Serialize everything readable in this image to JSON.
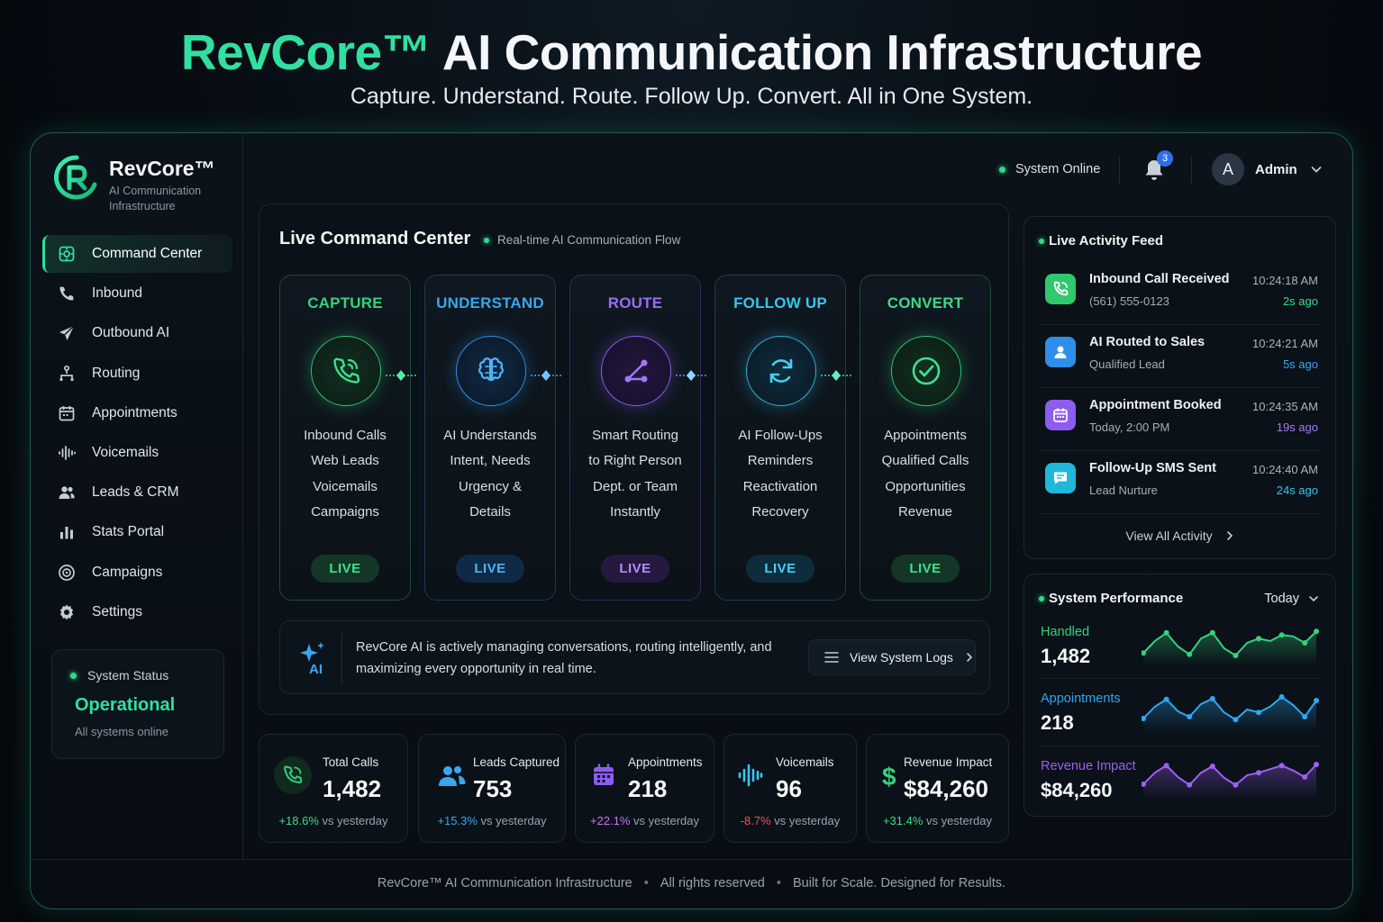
{
  "hero": {
    "brand": "RevCore™",
    "title_rest": " AI Communication Infrastructure",
    "subtitle": "Capture. Understand. Route. Follow Up. Convert. All in One System."
  },
  "sidebar": {
    "logo_name": "RevCore™",
    "logo_tagline": "AI Communication Infrastructure",
    "items": [
      {
        "label": "Command Center",
        "icon": "dashboard-icon",
        "active": true
      },
      {
        "label": "Inbound",
        "icon": "phone-icon"
      },
      {
        "label": "Outbound AI",
        "icon": "send-icon"
      },
      {
        "label": "Routing",
        "icon": "routing-icon"
      },
      {
        "label": "Appointments",
        "icon": "calendar-icon"
      },
      {
        "label": "Voicemails",
        "icon": "waveform-icon"
      },
      {
        "label": "Leads & CRM",
        "icon": "users-icon"
      },
      {
        "label": "Stats Portal",
        "icon": "bar-chart-icon"
      },
      {
        "label": "Campaigns",
        "icon": "target-icon"
      },
      {
        "label": "Settings",
        "icon": "gear-icon"
      }
    ],
    "system_status": {
      "label": "System Status",
      "value": "Operational",
      "sub": "All systems online"
    }
  },
  "header": {
    "status": "System Online",
    "notification_count": "3",
    "avatar_letter": "A",
    "user": "Admin"
  },
  "command_center": {
    "title": "Live Command Center",
    "subtitle": "Real-time AI Communication Flow",
    "stages": [
      {
        "title": "CAPTURE",
        "lines": [
          "Inbound Calls",
          "Web Leads",
          "Voicemails",
          "Campaigns"
        ],
        "status": "LIVE",
        "color": "#34d27b",
        "icon": "phone-icon"
      },
      {
        "title": "UNDERSTAND",
        "lines": [
          "AI Understands",
          "Intent, Needs",
          "Urgency &",
          "Details"
        ],
        "status": "LIVE",
        "color": "#3aa6f0",
        "icon": "brain-icon"
      },
      {
        "title": "ROUTE",
        "lines": [
          "Smart Routing",
          "to Right Person",
          "Dept. or Team",
          "Instantly"
        ],
        "status": "LIVE",
        "color": "#9b6cf5",
        "icon": "routing-icon"
      },
      {
        "title": "FOLLOW UP",
        "lines": [
          "AI Follow-Ups",
          "Reminders",
          "Reactivation",
          "Recovery"
        ],
        "status": "LIVE",
        "color": "#38c5ef",
        "icon": "refresh-icon"
      },
      {
        "title": "CONVERT",
        "lines": [
          "Appointments",
          "Qualified Calls",
          "Opportunities",
          "Revenue"
        ],
        "status": "LIVE",
        "color": "#3fd98a",
        "icon": "check-circle-icon"
      }
    ],
    "banner": {
      "ai_label": "AI",
      "message": "RevCore AI is actively managing conversations, routing intelligently, and maximizing every opportunity in real time.",
      "button": "View System Logs"
    }
  },
  "stats": [
    {
      "label": "Total Calls",
      "value": "1,482",
      "trend": "+18.6%",
      "trend_suffix": "vs yesterday",
      "color": "#34d27b",
      "icon": "phone-icon"
    },
    {
      "label": "Leads Captured",
      "value": "753",
      "trend": "+15.3%",
      "trend_suffix": "vs yesterday",
      "color": "#3aa6f0",
      "icon": "users-icon"
    },
    {
      "label": "Appointments",
      "value": "218",
      "trend": "+22.1%",
      "trend_suffix": "vs yesterday",
      "color": "#b06ef5",
      "icon": "calendar-icon"
    },
    {
      "label": "Voicemails",
      "value": "96",
      "trend": "-8.7%",
      "trend_suffix": "vs yesterday",
      "color": "#38c5ef",
      "trend_color": "#f05252",
      "icon": "waveform-icon"
    },
    {
      "label": "Revenue Impact",
      "value": "$84,260",
      "trend": "+31.4%",
      "trend_suffix": "vs yesterday",
      "color": "#34d27b",
      "icon": "dollar-icon"
    }
  ],
  "feed": {
    "title": "Live Activity Feed",
    "items": [
      {
        "title": "Inbound Call Received",
        "sub": "(561) 555-0123",
        "time": "10:24:18 AM",
        "ago": "2s ago",
        "color": "#2fc86e",
        "ago_color": "#3fd98a",
        "icon": "phone-icon"
      },
      {
        "title": "AI Routed to Sales",
        "sub": "Qualified Lead",
        "time": "10:24:21 AM",
        "ago": "5s ago",
        "color": "#2f8fe8",
        "ago_color": "#3aa6f0",
        "icon": "user-icon"
      },
      {
        "title": "Appointment Booked",
        "sub": "Today, 2:00 PM",
        "time": "10:24:35 AM",
        "ago": "19s ago",
        "color": "#8e5cf0",
        "ago_color": "#a878f7",
        "icon": "calendar-icon"
      },
      {
        "title": "Follow-Up SMS Sent",
        "sub": "Lead Nurture",
        "time": "10:24:40 AM",
        "ago": "24s ago",
        "color": "#1fb8d9",
        "ago_color": "#38c5ef",
        "icon": "message-icon"
      }
    ],
    "view_all": "View All Activity"
  },
  "performance": {
    "title": "System Performance",
    "period": "Today",
    "rows": [
      {
        "label": "Handled",
        "value": "1,482",
        "color": "#34d27b",
        "spark": [
          0.22,
          0.55,
          0.78,
          0.4,
          0.18,
          0.62,
          0.78,
          0.35,
          0.15,
          0.5,
          0.62,
          0.55,
          0.72,
          0.68,
          0.5,
          0.82
        ]
      },
      {
        "label": "Appointments",
        "value": "218",
        "color": "#2ea7f2",
        "spark": [
          0.25,
          0.58,
          0.78,
          0.45,
          0.3,
          0.65,
          0.8,
          0.42,
          0.22,
          0.5,
          0.42,
          0.58,
          0.85,
          0.62,
          0.3,
          0.75
        ]
      },
      {
        "label": "Revenue Impact",
        "value": "$84,260",
        "color": "#9f5ef5",
        "spark": [
          0.3,
          0.62,
          0.82,
          0.5,
          0.28,
          0.62,
          0.8,
          0.48,
          0.28,
          0.55,
          0.62,
          0.72,
          0.82,
          0.68,
          0.5,
          0.85
        ]
      }
    ]
  },
  "footer": {
    "parts": [
      "RevCore™ AI Communication Infrastructure",
      "All rights reserved",
      "Built for Scale. Designed for Results."
    ]
  }
}
